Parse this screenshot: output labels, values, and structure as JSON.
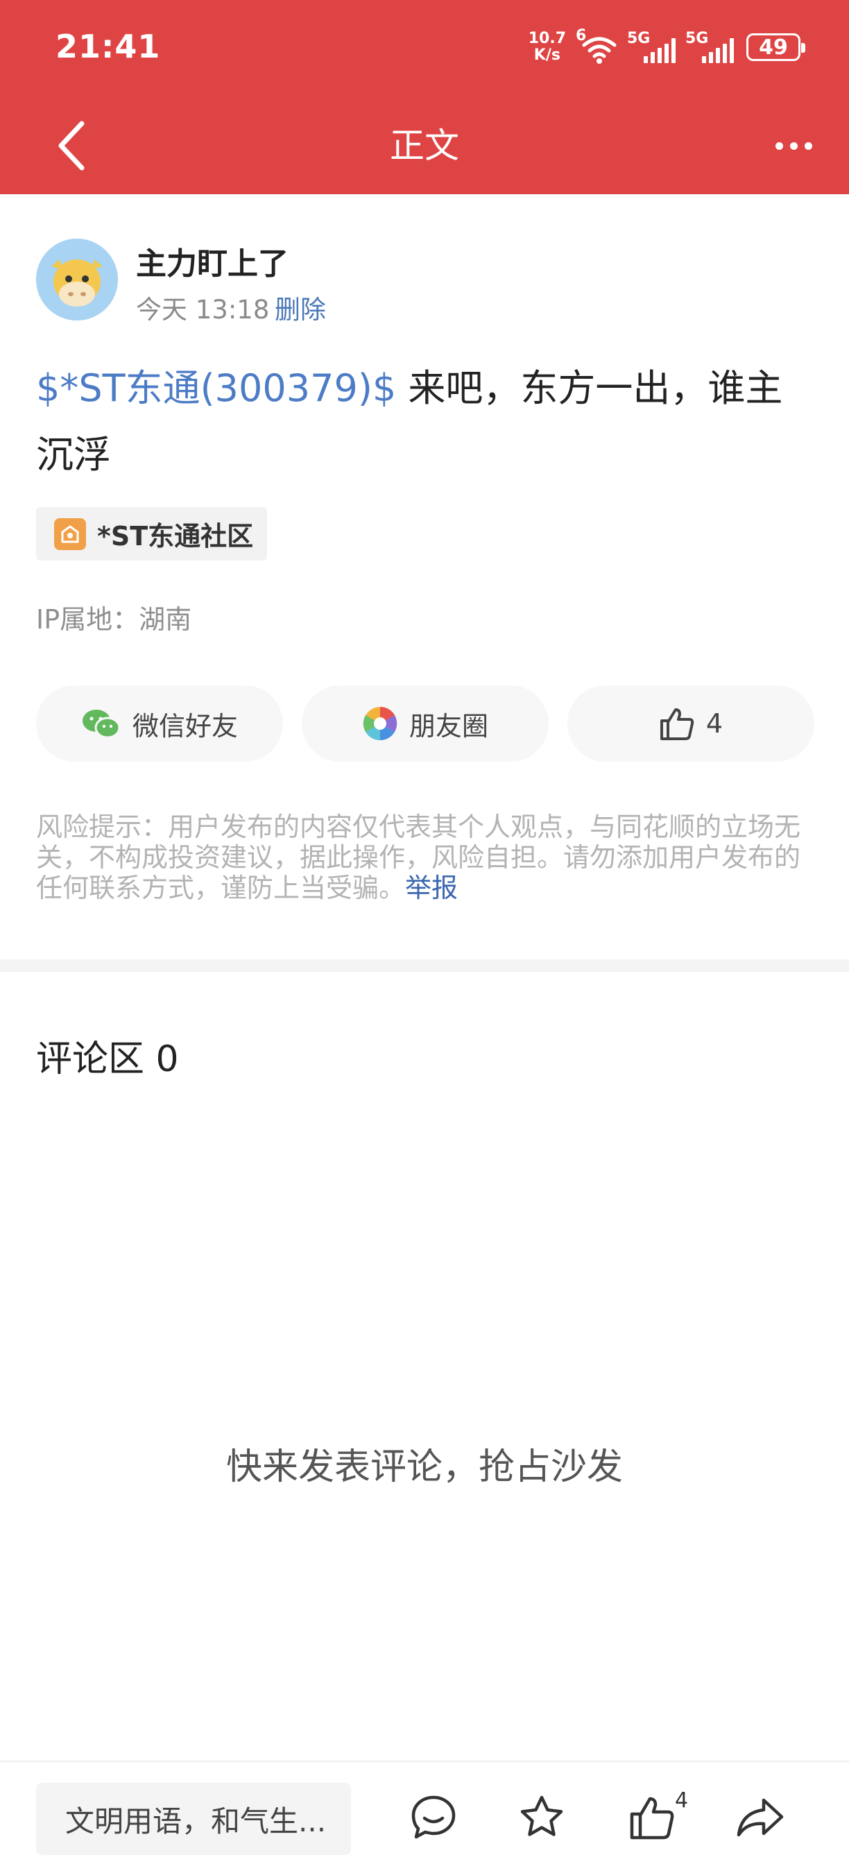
{
  "status_bar": {
    "time": "21:41",
    "net_speed_value": "10.7",
    "net_speed_unit": "K/s",
    "wifi_tag": "6",
    "sim1_label": "5G",
    "sim2_label": "5G",
    "battery": "49"
  },
  "header": {
    "title": "正文"
  },
  "post": {
    "author": "主力盯上了",
    "time": "今天 13:18",
    "delete_label": "删除",
    "stock_link": "$*ST东通(300379)$",
    "content": " 来吧，东方一出，谁主沉浮",
    "community": "*ST东通社区",
    "ip_location": "IP属地：湖南"
  },
  "share": {
    "wechat_label": "微信好友",
    "moments_label": "朋友圈",
    "like_count": "4"
  },
  "risk": {
    "text": "风险提示：用户发布的内容仅代表其个人观点，与同花顺的立场无关，不构成投资建议，据此操作，风险自担。请勿添加用户发布的任何联系方式，谨防上当受骗。",
    "report_label": "举报"
  },
  "comments": {
    "title": "评论区 0",
    "empty_text": "快来发表评论，抢占沙发"
  },
  "bottom_bar": {
    "input_placeholder": "文明用语，和气生...",
    "like_badge": "4"
  },
  "colors": {
    "header_red": "#df4444",
    "link_blue": "#4d7cc6",
    "report_blue": "#3a66b0"
  }
}
